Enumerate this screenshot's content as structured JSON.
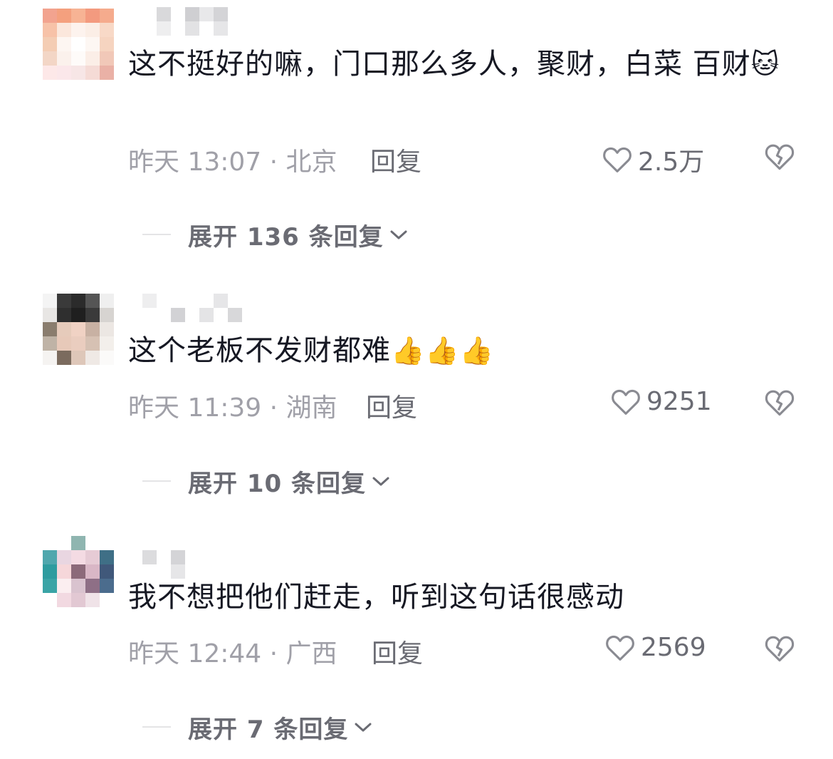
{
  "comments": [
    {
      "text": "这不挺好的嘛，门口那么多人，聚财，白菜 百财",
      "emoji": "🐱",
      "time": "昨天 13:07 · 北京",
      "reply_label": "回复",
      "likes": "2.5万",
      "expand_label": "展开 136 条回复"
    },
    {
      "text": "这个老板不发财都难",
      "emoji": "👍👍👍",
      "time": "昨天 11:39 · 湖南",
      "reply_label": "回复",
      "likes": "9251",
      "expand_label": "展开 10 条回复"
    },
    {
      "text": "我不想把他们赶走，听到这句话很感动",
      "emoji": "",
      "time": "昨天 12:44 · 广西",
      "reply_label": "回复",
      "likes": "2569",
      "expand_label": "展开 7 条回复"
    }
  ],
  "icons": {
    "like": "heart-outline-icon",
    "dislike": "broken-heart-icon",
    "expand": "chevron-down-icon"
  },
  "colors": {
    "text": "#161823",
    "meta": "#a0a0a8",
    "action": "#6a6b73"
  }
}
